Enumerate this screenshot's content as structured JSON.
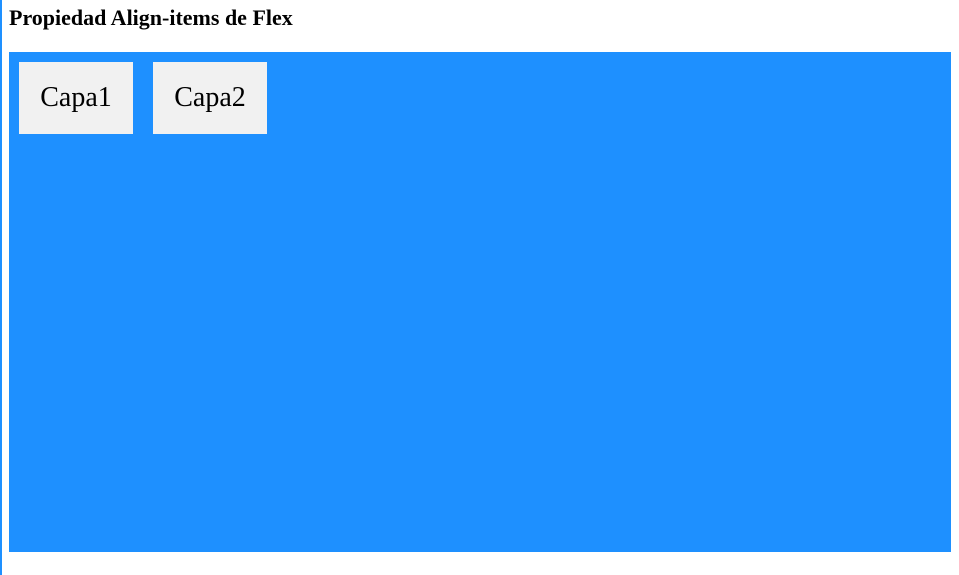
{
  "page": {
    "title": "Propiedad Align-items de Flex"
  },
  "container": {
    "background": "#1e90ff",
    "items": [
      {
        "label": "Capa1"
      },
      {
        "label": "Capa2"
      }
    ],
    "item_background": "#f1f1f1"
  }
}
